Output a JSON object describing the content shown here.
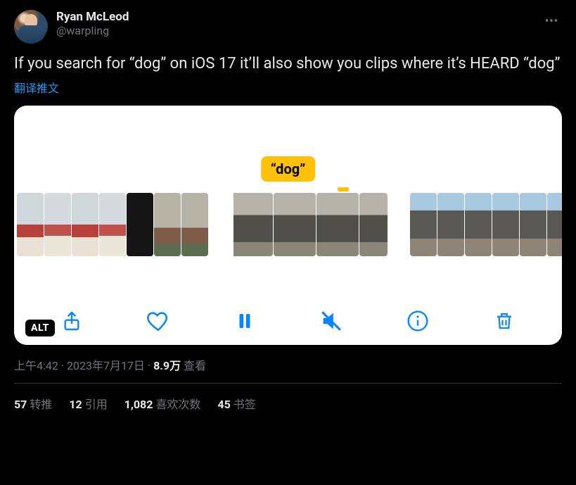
{
  "author": {
    "display_name": "Ryan McLeod",
    "handle": "@warpling"
  },
  "tweet_text": "If you search for “dog” on iOS 17 it’ll also show you clips where it’s HEARD “dog”",
  "translate_label": "翻译推文",
  "media": {
    "caption_label": "“dog”",
    "alt_badge": "ALT"
  },
  "meta": {
    "time": "上午4:42",
    "separator1": " · ",
    "date": "2023年7月17日",
    "separator2": " · ",
    "views_count": "8.9万",
    "views_label": " 查看"
  },
  "stats": {
    "retweets": {
      "count": "57",
      "label": "转推"
    },
    "quotes": {
      "count": "12",
      "label": "引用"
    },
    "likes": {
      "count": "1,082",
      "label": "喜欢次数"
    },
    "bookmarks": {
      "count": "45",
      "label": "书签"
    }
  }
}
